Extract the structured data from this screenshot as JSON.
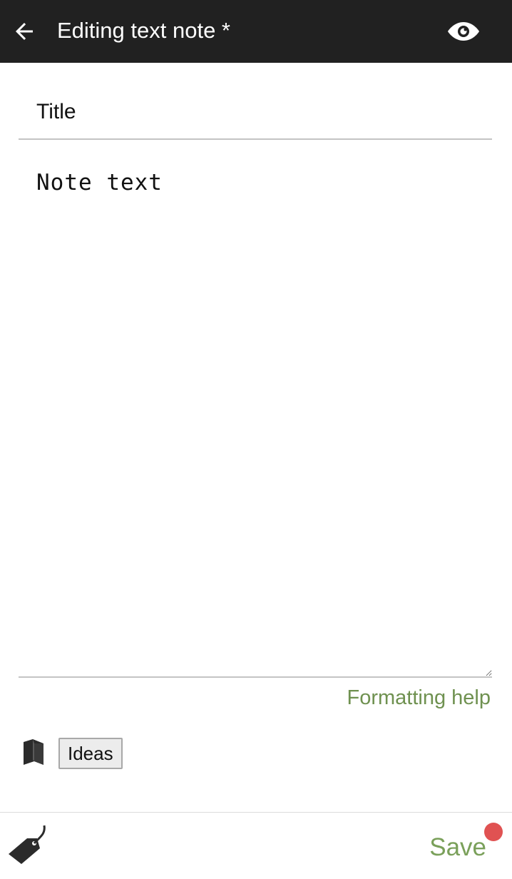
{
  "appbar": {
    "title": "Editing text note *",
    "back_icon": "arrow-left-icon",
    "preview_icon": "eye-icon",
    "background": "#212121"
  },
  "editor": {
    "title_placeholder": "Title",
    "title_value": "",
    "text_placeholder": "Note text",
    "text_value": ""
  },
  "formatting_help": {
    "label": "Formatting help",
    "color": "#6f9150"
  },
  "notebook": {
    "icon": "notebook-icon",
    "label": "Ideas"
  },
  "bottombar": {
    "tag_icon": "tag-icon",
    "save_label": "Save",
    "save_color": "#7aa05a",
    "unsaved_indicator_color": "#e05252"
  }
}
